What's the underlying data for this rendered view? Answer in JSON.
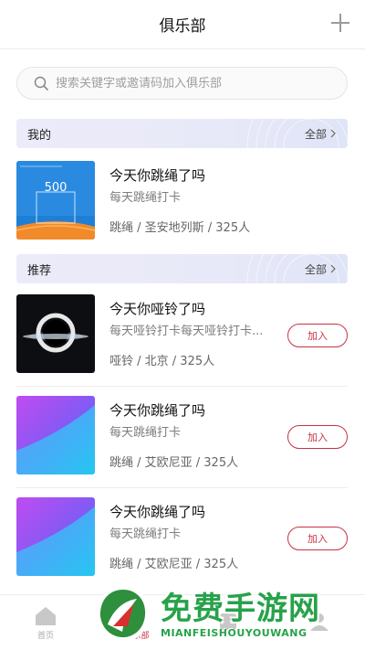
{
  "header": {
    "title": "俱乐部"
  },
  "search": {
    "placeholder": "搜索关键字或邀请码加入俱乐部"
  },
  "sections": {
    "mine": {
      "label": "我的",
      "all": "全部"
    },
    "recommend": {
      "label": "推荐",
      "all": "全部"
    }
  },
  "mine_clubs": [
    {
      "name": "今天你跳绳了吗",
      "desc": "每天跳绳打卡",
      "meta": "跳绳 / 圣安地列斯 / 325人",
      "thumb_number": "500"
    }
  ],
  "recommended_clubs": [
    {
      "name": "今天你哑铃了吗",
      "desc": "每天哑铃打卡每天哑铃打卡...",
      "meta": "哑铃 / 北京 / 325人",
      "join": "加入"
    },
    {
      "name": "今天你跳绳了吗",
      "desc": "每天跳绳打卡",
      "meta": "跳绳 / 艾欧尼亚 / 325人",
      "join": "加入"
    },
    {
      "name": "今天你跳绳了吗",
      "desc": "每天跳绳打卡",
      "meta": "跳绳 / 艾欧尼亚 / 325人",
      "join": "加入"
    }
  ],
  "tabbar": {
    "home": "首页",
    "club": "俱乐部"
  },
  "watermark": {
    "title": "免费手游网",
    "subtitle": "MIANFEISHOUYOUWANG"
  },
  "colors": {
    "accent": "#c53443",
    "watermark_green": "#27a24a"
  }
}
